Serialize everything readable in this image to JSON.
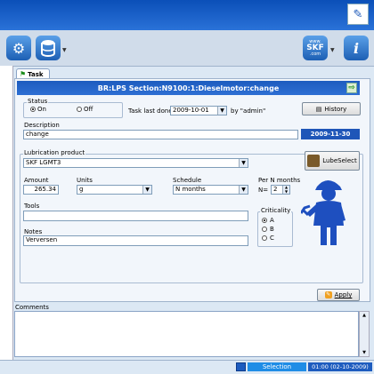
{
  "toolbar": {
    "skf_logo_text": "SKF",
    "skf_logo_sub": "www.",
    "skf_logo_com": ".com"
  },
  "tab": {
    "label": "Task"
  },
  "header": {
    "title": "BR:LPS Section:N9100:1:Dieselmotor:change"
  },
  "status": {
    "group_label": "Status",
    "on_label": "On",
    "off_label": "Off",
    "selected": "On"
  },
  "last_done": {
    "label": "Task last done:",
    "value": "2009-10-01",
    "by": "by \"admin\""
  },
  "history_label": "History",
  "description": {
    "label": "Description",
    "value": "change"
  },
  "date_badge": "2009-11-30",
  "lubrication": {
    "group_label": "Lubrication product",
    "value": "SKF LGMT3"
  },
  "lubeselect_label": "LubeSelect",
  "amount": {
    "label": "Amount",
    "value": "265.34"
  },
  "units": {
    "label": "Units",
    "value": "g"
  },
  "schedule": {
    "label": "Schedule",
    "value": "N months"
  },
  "per_n": {
    "label": "Per N months",
    "prefix": "N=",
    "value": "2"
  },
  "tools": {
    "label": "Tools",
    "value": ""
  },
  "criticality": {
    "label": "Criticality",
    "options": [
      "A",
      "B",
      "C"
    ],
    "selected": "A"
  },
  "notes": {
    "label": "Notes",
    "value": "Verversen"
  },
  "apply_label": "Apply",
  "comments": {
    "label": "Comments",
    "value": ""
  },
  "statusbar": {
    "selection": "Selection",
    "time": "01:00 (02-10-2009)"
  },
  "colors": {
    "accent": "#1d5cbf",
    "worker": "#1e4fbf"
  }
}
